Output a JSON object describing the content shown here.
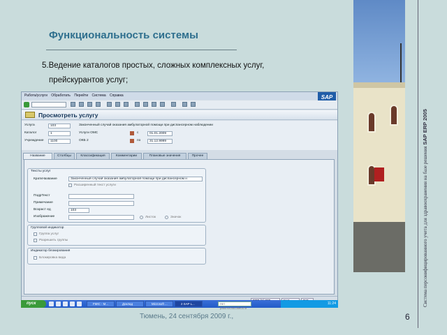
{
  "slide": {
    "title": "Функциональность системы",
    "bullet_line1": "5.Ведение каталогов простых, сложных комплексных  услуг,",
    "bullet_line2": "прейскурантов услуг;",
    "footer": "Тюмень, 24 сентября 2009 г.,",
    "page_number": "6",
    "vertical_text": "Система персонифицированного учета для здравоохранения на базе решения",
    "vertical_text_bold": "SAP ERP 2005"
  },
  "sap": {
    "menu": [
      "Работа/услуги",
      "Обработать",
      "Перейти",
      "Система",
      "Справка"
    ],
    "logo": "SAP",
    "screen_title": "Просмотреть услугу",
    "header": {
      "service_label": "Услуга",
      "service_value": "103",
      "service_desc": "Законченный случай оказания амбулаторной помощи при диспансерном наблюдении",
      "catalog_label": "Каталог",
      "catalog_value": "1",
      "catalog_desc": "Услуги ОМС",
      "institution_label": "Учреждение",
      "institution_value": "1100",
      "institution_desc": "ОКБ 2",
      "date_from_prefix": "с",
      "date_from": "01.01.2009",
      "date_to_prefix": "по",
      "date_to": "31.12.9999"
    },
    "tabs": [
      "Название",
      "Столбцы",
      "Классификация",
      "Комментарии",
      "Плановые значения",
      "Прочее"
    ],
    "texts_group": {
      "title": "Тексты услуг",
      "short_label": "КраткНазвание",
      "short_value": "Законченный случай оказания амбулаторной помощи при диспансерном н",
      "checkbox_label": "Расширенный текст услуги",
      "subtext_label": "ПодрТекст",
      "note_label": "Примечание",
      "age_label": "Возраст ед",
      "age_value": "103",
      "image_label": "Изображение",
      "radio1": "Листок",
      "radio2": "Значок"
    },
    "group_indicator": {
      "title": "Групповой индикатор",
      "opt1": "Группа услуг",
      "opt2": "Разрешить группы"
    },
    "lock_indicator": {
      "title": "Индикатор блокирования",
      "opt1": "Блокировка вида"
    },
    "status": {
      "system": "ERP (1) 800",
      "server": "tsa1",
      "mode": "INS"
    }
  },
  "taskbar": {
    "start": "пуск",
    "items": [
      "FMIC - M...",
      "Доклад",
      "Microsoft ...",
      "2 SAP L..."
    ],
    "search_placeholder": "Нет работоспособности",
    "clock": "11:24"
  }
}
